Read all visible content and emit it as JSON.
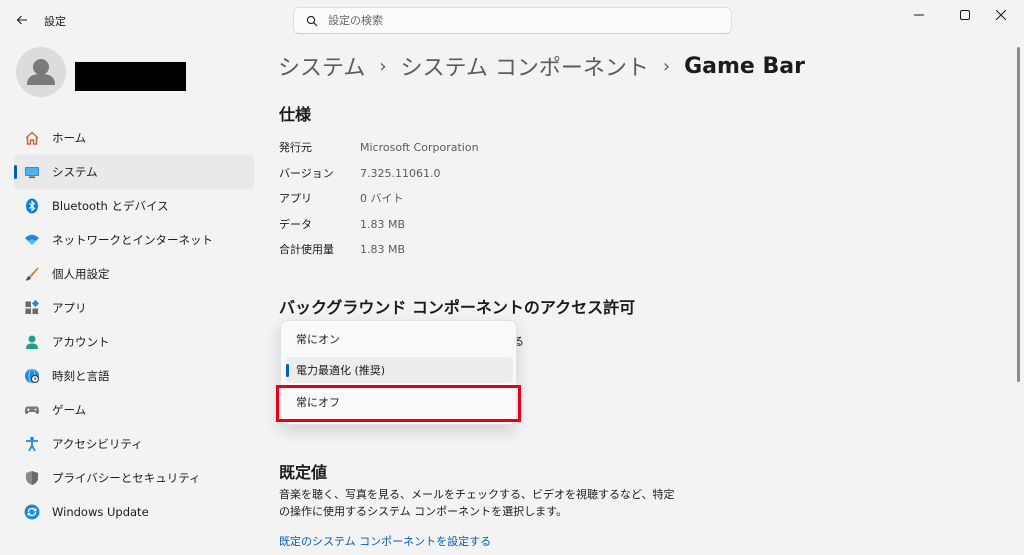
{
  "app": {
    "title": "設定"
  },
  "search": {
    "placeholder": "設定の検索"
  },
  "sidebar": {
    "items": [
      {
        "label": "ホーム",
        "icon": "home-icon",
        "active": false
      },
      {
        "label": "システム",
        "icon": "system-icon",
        "active": true
      },
      {
        "label": "Bluetooth とデバイス",
        "icon": "bluetooth-icon",
        "active": false
      },
      {
        "label": "ネットワークとインターネット",
        "icon": "wifi-icon",
        "active": false
      },
      {
        "label": "個人用設定",
        "icon": "brush-icon",
        "active": false
      },
      {
        "label": "アプリ",
        "icon": "apps-icon",
        "active": false
      },
      {
        "label": "アカウント",
        "icon": "account-icon",
        "active": false
      },
      {
        "label": "時刻と言語",
        "icon": "globe-clock-icon",
        "active": false
      },
      {
        "label": "ゲーム",
        "icon": "gamepad-icon",
        "active": false
      },
      {
        "label": "アクセシビリティ",
        "icon": "accessibility-icon",
        "active": false
      },
      {
        "label": "プライバシーとセキュリティ",
        "icon": "shield-icon",
        "active": false
      },
      {
        "label": "Windows Update",
        "icon": "update-icon",
        "active": false
      }
    ]
  },
  "breadcrumb": {
    "parts": [
      "システム",
      "システム コンポーネント"
    ],
    "separator": "›",
    "current": "Game Bar"
  },
  "specs": {
    "heading": "仕様",
    "rows": [
      {
        "label": "発行元",
        "value": "Microsoft Corporation"
      },
      {
        "label": "バージョン",
        "value": "7.325.11061.0"
      },
      {
        "label": "アプリ",
        "value": "0 バイト"
      },
      {
        "label": "データ",
        "value": "1.83 MB"
      },
      {
        "label": "合計使用量",
        "value": "1.83 MB"
      }
    ]
  },
  "background": {
    "heading": "バックグラウンド コンポーネントのアクセス許可",
    "description_tail": "る",
    "options": [
      {
        "label": "常にオン",
        "selected": false
      },
      {
        "label": "電力最適化 (推奨)",
        "selected": true
      },
      {
        "label": "常にオフ",
        "selected": false,
        "highlighted": true
      }
    ]
  },
  "defaults": {
    "heading": "既定値",
    "description": "音楽を聴く、写真を見る、メールをチェックする、ビデオを視聴するなど、特定の操作に使用するシステム コンポーネントを選択します。",
    "link": "既定のシステム コンポーネントを設定する"
  },
  "colors": {
    "accent": "#005fb8",
    "highlight": "#e5001a"
  }
}
